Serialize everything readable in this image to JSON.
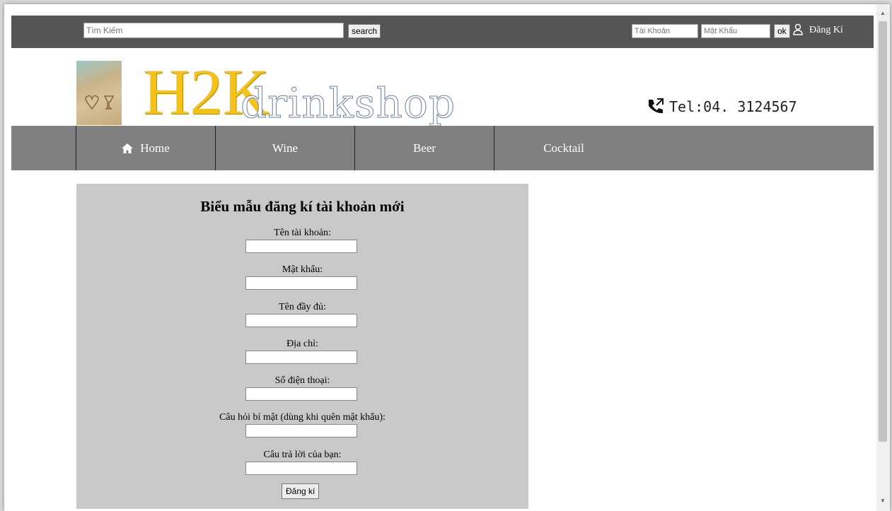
{
  "topbar": {
    "search_placeholder": "Tìm Kiếm",
    "search_button": "search",
    "username_placeholder": "Tài Khoản",
    "password_placeholder": "Mật Khẩu",
    "ok_button": "ok",
    "register_link": "Đăng Kí"
  },
  "header": {
    "logo_main": "H2K",
    "logo_sub": "drinkshop",
    "phone": "Tel:04. 3124567"
  },
  "nav": {
    "items": [
      {
        "label": "Home",
        "icon": "home-icon"
      },
      {
        "label": "Wine"
      },
      {
        "label": "Beer"
      },
      {
        "label": "Cocktail"
      }
    ]
  },
  "form": {
    "title": "Biểu mẫu đăng kí tài khoản mới",
    "fields": [
      {
        "label": "Tên tài khoản:",
        "value": ""
      },
      {
        "label": "Mật khẩu:",
        "value": ""
      },
      {
        "label": "Tên đầy đủ:",
        "value": ""
      },
      {
        "label": "Địa chỉ:",
        "value": ""
      },
      {
        "label": "Số điện thoại:",
        "value": ""
      },
      {
        "label": "Câu hỏi bí mật (dùng khi quên mật khẩu):",
        "value": ""
      },
      {
        "label": "Câu trả lời của bạn:",
        "value": ""
      }
    ],
    "submit": "Đăng kí"
  },
  "colors": {
    "topbar": "#555555",
    "nav": "#808080",
    "form_panel": "#c9c9c9",
    "logo_accent": "#f5c21a"
  }
}
